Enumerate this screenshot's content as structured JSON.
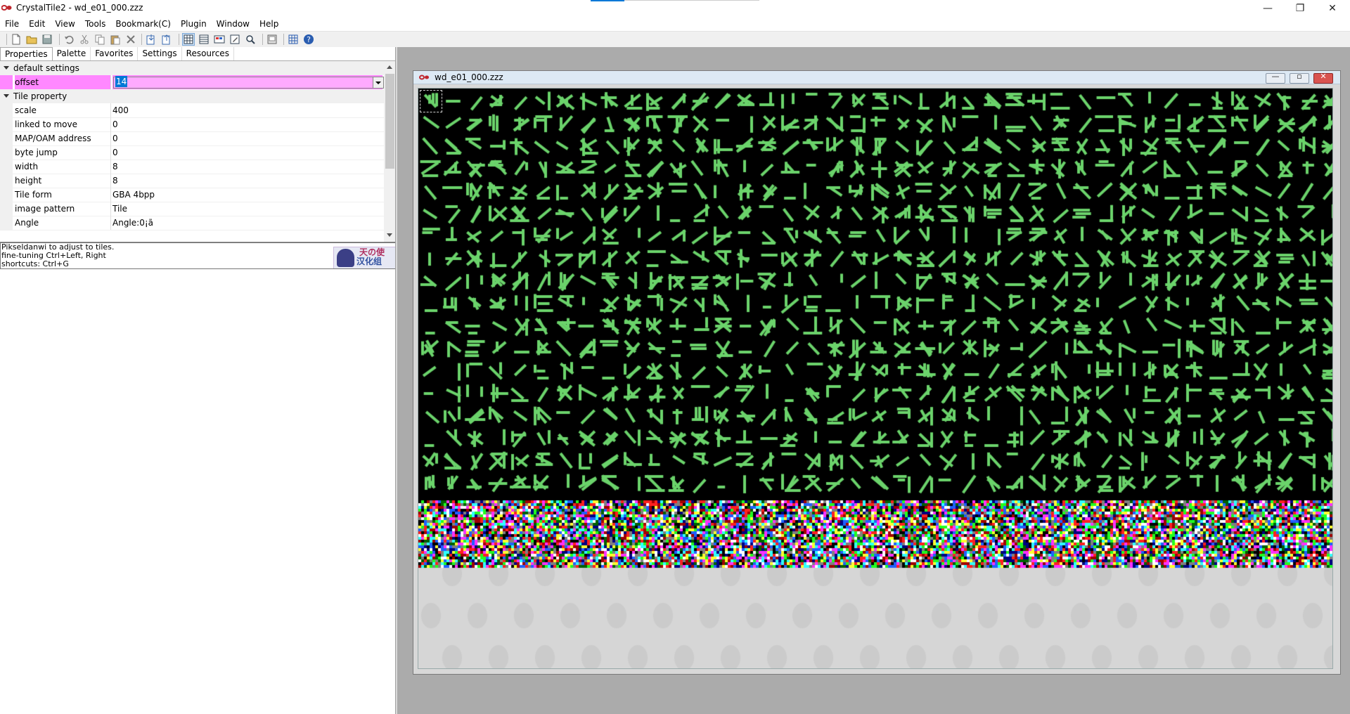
{
  "window": {
    "title": "CrystalTile2 - wd_e01_000.zzz",
    "minimize": "—",
    "maximize": "❐",
    "close": "✕"
  },
  "menu": [
    "File",
    "Edit",
    "View",
    "Tools",
    "Bookmark(C)",
    "Plugin",
    "Window",
    "Help"
  ],
  "toolbar_icons": [
    "new-file-icon",
    "open-folder-icon",
    "save-icon",
    "undo-icon",
    "cut-icon",
    "copy-icon",
    "paste-icon",
    "delete-icon",
    "import-icon",
    "export-icon",
    "tile-view-icon",
    "tile-editor-icon",
    "palette-icon",
    "edit-icon",
    "search-icon",
    "screenshot-icon",
    "grid-icon",
    "help-icon"
  ],
  "tabs": [
    "Properties",
    "Palette",
    "Favorites",
    "Settings",
    "Resources"
  ],
  "properties": {
    "category1": "default settings",
    "offset_label": "offset",
    "offset_value": "14",
    "category2": "Tile property",
    "rows": [
      {
        "name": "scale",
        "value": "400"
      },
      {
        "name": "linked to move",
        "value": "0"
      },
      {
        "name": "MAP/OAM address",
        "value": "0"
      },
      {
        "name": "byte jump",
        "value": "0"
      },
      {
        "name": "width",
        "value": "8"
      },
      {
        "name": "height",
        "value": "8"
      },
      {
        "name": "Tile form",
        "value": "GBA 4bpp"
      },
      {
        "name": "image pattern",
        "value": "Tile"
      },
      {
        "name": "Angle",
        "value": "Angle:0¡ã"
      }
    ]
  },
  "help": {
    "line1": "Pikseldanwi to adjust to tiles.",
    "line2": "fine-tuning Ctrl+Left, Right",
    "line3": "shortcuts: Ctrl+G",
    "logo_top": "天の使",
    "logo_bottom": "汉化组"
  },
  "child": {
    "title": "wd_e01_000.zzz",
    "minimize": "—",
    "maximize": "▫",
    "close": "✕"
  },
  "colors": {
    "glyph_green": "#6bd36b",
    "tile_background": "#000000",
    "selected_row": "#ff88ff",
    "accent": "#0078d7"
  }
}
